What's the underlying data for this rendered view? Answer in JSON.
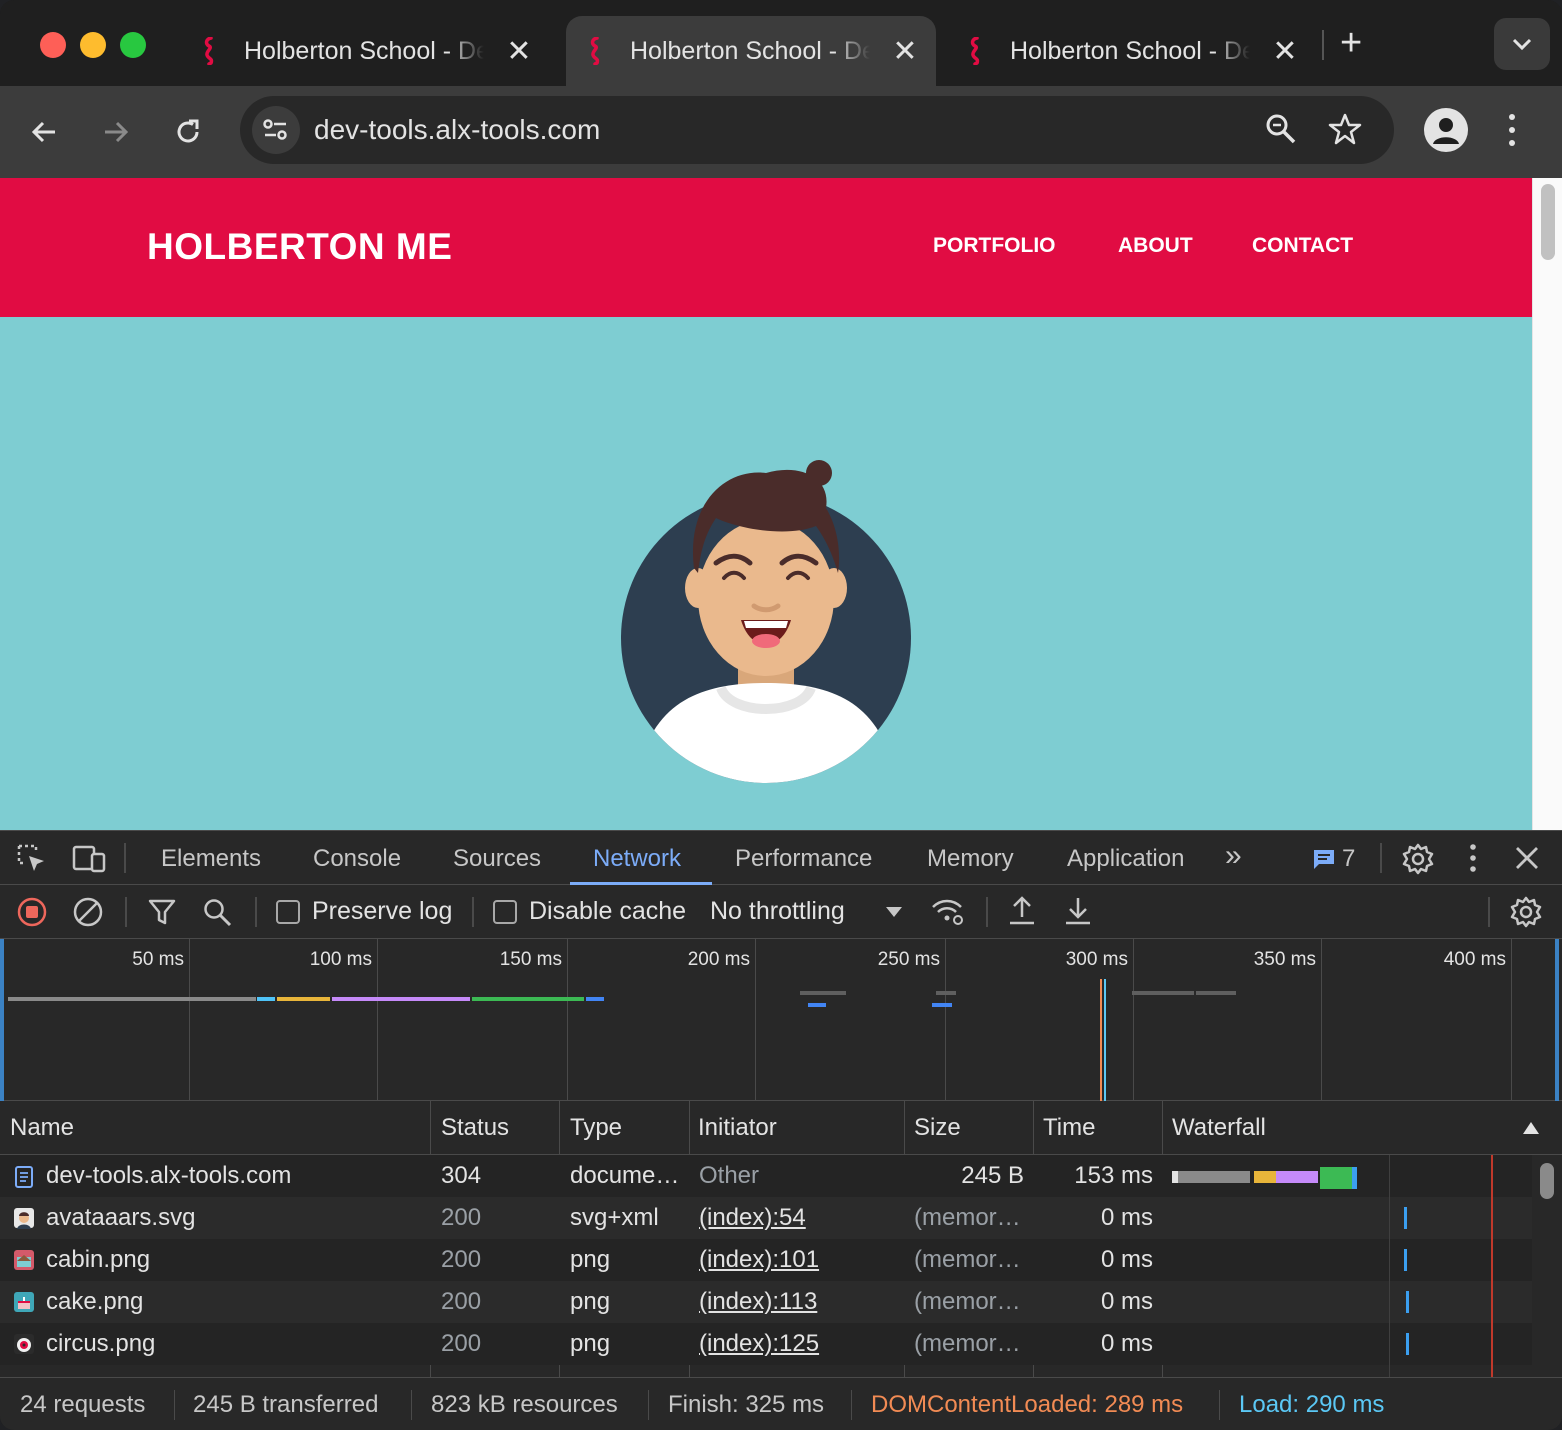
{
  "browser": {
    "tabs": [
      {
        "title": "Holberton School - Dev Tools",
        "close": "✕",
        "active": false
      },
      {
        "title": "Holberton School - Dev Tools",
        "close": "✕",
        "active": true
      },
      {
        "title": "Holberton School - Dev Tools",
        "close": "✕",
        "active": false
      }
    ],
    "new_tab": "+",
    "url": "dev-tools.alx-tools.com"
  },
  "page": {
    "brand": "HOLBERTON ME",
    "nav": [
      "PORTFOLIO",
      "ABOUT",
      "CONTACT"
    ],
    "colors": {
      "header": "#e10c43",
      "hero": "#7ecdd2",
      "avatar_bg": "#2d3e50"
    }
  },
  "devtools": {
    "tabs": [
      "Elements",
      "Console",
      "Sources",
      "Network",
      "Performance",
      "Memory",
      "Application"
    ],
    "active_tab": "Network",
    "more_tabs": "»",
    "issues_count": "7",
    "toolbar": {
      "preserve_log": "Preserve log",
      "disable_cache": "Disable cache",
      "throttling": "No throttling"
    },
    "overview_ticks": [
      "50 ms",
      "100 ms",
      "150 ms",
      "200 ms",
      "250 ms",
      "300 ms",
      "350 ms",
      "400 ms"
    ],
    "columns": [
      "Name",
      "Status",
      "Type",
      "Initiator",
      "Size",
      "Time",
      "Waterfall"
    ],
    "rows": [
      {
        "name": "dev-tools.alx-tools.com",
        "status": "304",
        "type": "docume…",
        "initiator": "Other",
        "size": "245 B",
        "time": "153 ms",
        "icon": "document-icon"
      },
      {
        "name": "avataaars.svg",
        "status": "200",
        "type": "svg+xml",
        "initiator": "(index):54",
        "size": "(memor…",
        "time": "0 ms",
        "icon": "svg-thumbnail-icon"
      },
      {
        "name": "cabin.png",
        "status": "200",
        "type": "png",
        "initiator": "(index):101",
        "size": "(memor…",
        "time": "0 ms",
        "icon": "image-thumbnail-icon"
      },
      {
        "name": "cake.png",
        "status": "200",
        "type": "png",
        "initiator": "(index):113",
        "size": "(memor…",
        "time": "0 ms",
        "icon": "image-thumbnail-icon"
      },
      {
        "name": "circus.png",
        "status": "200",
        "type": "png",
        "initiator": "(index):125",
        "size": "(memor…",
        "time": "0 ms",
        "icon": "image-thumbnail-icon"
      }
    ],
    "summary": {
      "requests": "24 requests",
      "transferred": "245 B transferred",
      "resources": "823 kB resources",
      "finish": "Finish: 325 ms",
      "dom_content_loaded": "DOMContentLoaded: 289 ms",
      "load": "Load: 290 ms"
    },
    "colors": {
      "dcl": "#f28b54",
      "load": "#5bc8f5",
      "active_tab": "#7cacf8"
    }
  }
}
